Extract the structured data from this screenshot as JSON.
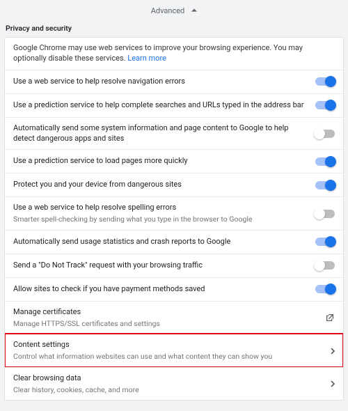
{
  "header": {
    "advanced_label": "Advanced"
  },
  "section": {
    "title": "Privacy and security"
  },
  "intro": {
    "text": "Google Chrome may use web services to improve your browsing experience. You may optionally disable these services. ",
    "link": "Learn more"
  },
  "toggles": [
    {
      "title": "Use a web service to help resolve navigation errors",
      "sub": "",
      "on": true
    },
    {
      "title": "Use a prediction service to help complete searches and URLs typed in the address bar",
      "sub": "",
      "on": true
    },
    {
      "title": "Automatically send some system information and page content to Google to help detect dangerous apps and sites",
      "sub": "",
      "on": false
    },
    {
      "title": "Use a prediction service to load pages more quickly",
      "sub": "",
      "on": true
    },
    {
      "title": "Protect you and your device from dangerous sites",
      "sub": "",
      "on": true
    },
    {
      "title": "Use a web service to help resolve spelling errors",
      "sub": "Smarter spell-checking by sending what you type in the browser to Google",
      "on": false
    },
    {
      "title": "Automatically send usage statistics and crash reports to Google",
      "sub": "",
      "on": true
    },
    {
      "title": "Send a \"Do Not Track\" request with your browsing traffic",
      "sub": "",
      "on": false
    },
    {
      "title": "Allow sites to check if you have payment methods saved",
      "sub": "",
      "on": true
    }
  ],
  "links": [
    {
      "title": "Manage certificates",
      "sub": "Manage HTTPS/SSL certificates and settings",
      "icon": "launch",
      "highlight": false
    },
    {
      "title": "Content settings",
      "sub": "Control what information websites can use and what content they can show you",
      "icon": "chevron",
      "highlight": true
    },
    {
      "title": "Clear browsing data",
      "sub": "Clear history, cookies, cache, and more",
      "icon": "chevron",
      "highlight": false
    }
  ]
}
